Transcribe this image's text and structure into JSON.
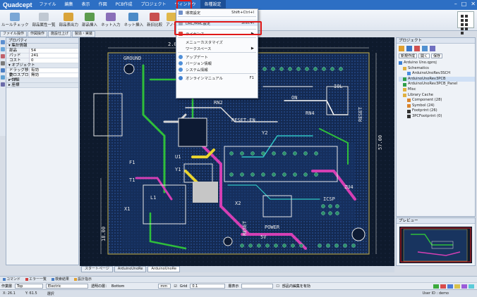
{
  "app": {
    "logo": "Quadcept"
  },
  "menu": [
    "ファイル",
    "編集",
    "表示",
    "作図",
    "PCB作成",
    "プロジェクト",
    "ウィンドウ",
    "各種設定"
  ],
  "ribbon": [
    "ルールチェック",
    "部品属性一覧",
    "部品表出力",
    "部品挿入",
    "ネット入力",
    "ネット挿入",
    "新旧比較",
    "アノテ"
  ],
  "subtabs": [
    "ファイル操作",
    "作図操作",
    "施設仕上げ",
    "製造・実装"
  ],
  "dropdown": {
    "items": [
      {
        "label": "環境設定",
        "shortcut": "Shift+Ctrl+I"
      },
      {
        "label": "DRC/MRC設定",
        "shortcut": "Shift+I"
      },
      {
        "label": "ライセンス",
        "shortcut": "▶"
      },
      {
        "label": "メニューカスタマイズ",
        "shortcut": ""
      },
      {
        "label": "ワークスペース",
        "shortcut": "▶"
      },
      {
        "label": "アップデート",
        "shortcut": ""
      },
      {
        "label": "バージョン情報",
        "shortcut": ""
      },
      {
        "label": "システム情報",
        "shortcut": ""
      },
      {
        "label": "オンラインマニュアル",
        "shortcut": "F1"
      }
    ]
  },
  "property": {
    "title": "プロパティ",
    "sec1": "集計情報",
    "rows1": [
      {
        "k": "部品",
        "v": "54"
      },
      {
        "k": "パッド",
        "v": "241"
      },
      {
        "k": "コスト",
        "v": "0"
      }
    ],
    "sec2": "オブジェクト",
    "rows2": [
      {
        "k": "ドラッグ移動",
        "v": "有効"
      },
      {
        "k": "クロスプローブ",
        "v": "無効"
      }
    ],
    "sec3": "詳細",
    "sec4": "座標"
  },
  "project": {
    "title": "プロジェクト",
    "btn_new": "新規作成",
    "btn_open": "開く",
    "btn_save": "保存",
    "tree": [
      "Arduino Uno.qproj",
      "Schematics",
      "ArduinoUnoRev3SCH",
      "ArduinoUnoRev3PCB",
      "ArduinoUnoRev3PCB_Panel",
      "Misc",
      "Library Cache",
      "Component (28)",
      "Symbol (24)",
      "Footprint (26)",
      "3PCFootprint (0)"
    ],
    "preview_title": "プレビュー"
  },
  "pcb_labels": [
    "GROUND",
    "IOL",
    "RESET",
    "RESET-EN",
    "ON",
    "RN4",
    "RN2",
    "ICSP",
    "POWER",
    "X1",
    "T1",
    "F1",
    "L1",
    "U1",
    "Y2",
    "Y1",
    "ZU4",
    "X2",
    "2.00",
    "57.00",
    "18.00",
    "RESET",
    "5V"
  ],
  "doctabs": [
    "スタートページ",
    "ArduinoUnoRe",
    "ArduinoUnoRe"
  ],
  "msgtabs": [
    "コマンド",
    "エラー一覧",
    "検索結果",
    "設計指示"
  ],
  "options": {
    "layer_label": "作業層",
    "layer_value": "Top",
    "net_value": "Electric",
    "rel_label": "透明の層：",
    "rel_value": "Bottom",
    "unit": "mm",
    "grid_label": "Grid",
    "grid_value": "0.1",
    "display_label": "層表示",
    "display_value": "",
    "checkbox_label": "部品内編集を有効"
  },
  "status": {
    "x": "X: 26.1",
    "y": "Y: 61.5",
    "mode": "選択",
    "user": "User ID : demo"
  }
}
